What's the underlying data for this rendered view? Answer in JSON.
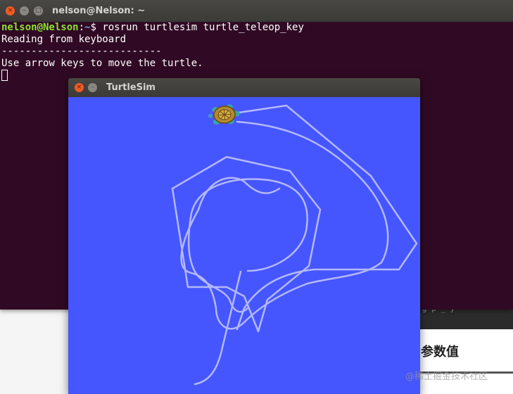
{
  "terminal": {
    "title": "nelson@Nelson: ~",
    "close_glyph": "×",
    "min_glyph": "–",
    "max_glyph": "□",
    "prompt_user": "nelson@Nelson",
    "prompt_sep": ":",
    "prompt_path": "~",
    "prompt_symbol": "$ ",
    "command": "rosrun turtlesim turtle_teleop_key",
    "lines": [
      "Reading from keyboard",
      "---------------------------",
      "Use arrow keys to move the turtle."
    ]
  },
  "turtlesim": {
    "title": "TurtleSim",
    "close_glyph": "×",
    "min_glyph": "–",
    "background_color": "#4556ff",
    "pen_color": "#b3b8ff"
  },
  "background": {
    "heading_fragment": "参数值",
    "watermark": "@稀土掘金技术社区",
    "code_fragment": "g  p    _ y"
  }
}
